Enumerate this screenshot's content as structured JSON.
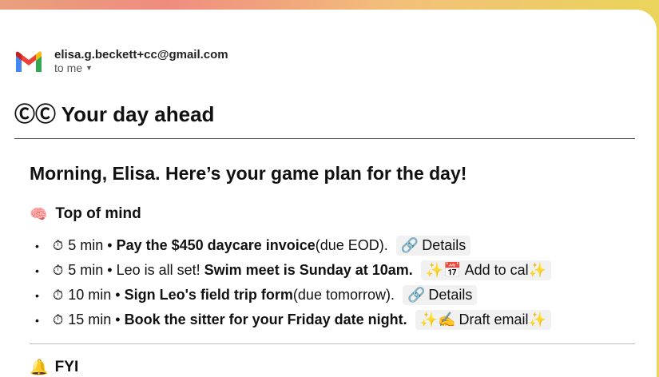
{
  "header": {
    "sender_email": "elisa.g.beckett+cc@gmail.com",
    "to_label": "to me",
    "subject": "ⒸⒸ Your day ahead"
  },
  "greeting": "Morning, Elisa. Here’s your game plan for the day!",
  "top_of_mind": {
    "icon": "brain-icon",
    "title": "Top of mind",
    "items": [
      {
        "time": "5 min •",
        "bold": "Pay the $450 daycare invoice",
        "rest": " (due EOD).",
        "action_icon": "🔗",
        "action": "Details",
        "action_suffix": ""
      },
      {
        "time": "5 min • Leo is all set!",
        "bold": "Swim meet is Sunday at 10am.",
        "rest": "",
        "action_icon": "✨📅",
        "action": "Add to cal",
        "action_suffix": "✨"
      },
      {
        "time": "10 min •",
        "bold": "Sign Leo's field trip form",
        "rest": " (due tomorrow).",
        "action_icon": "🔗",
        "action": "Details",
        "action_suffix": ""
      },
      {
        "time": "15 min •",
        "bold": "Book the sitter for your Friday date night.",
        "rest": "",
        "action_icon": "✨✍️",
        "action": "Draft email",
        "action_suffix": "✨"
      }
    ]
  },
  "fyi": {
    "icon": "bell-icon",
    "title": "FYI"
  },
  "colors": {
    "gmail_red": "#ea4335",
    "gmail_blue": "#4285f4",
    "gmail_green": "#34a853",
    "gmail_yellow": "#fbbc04"
  }
}
